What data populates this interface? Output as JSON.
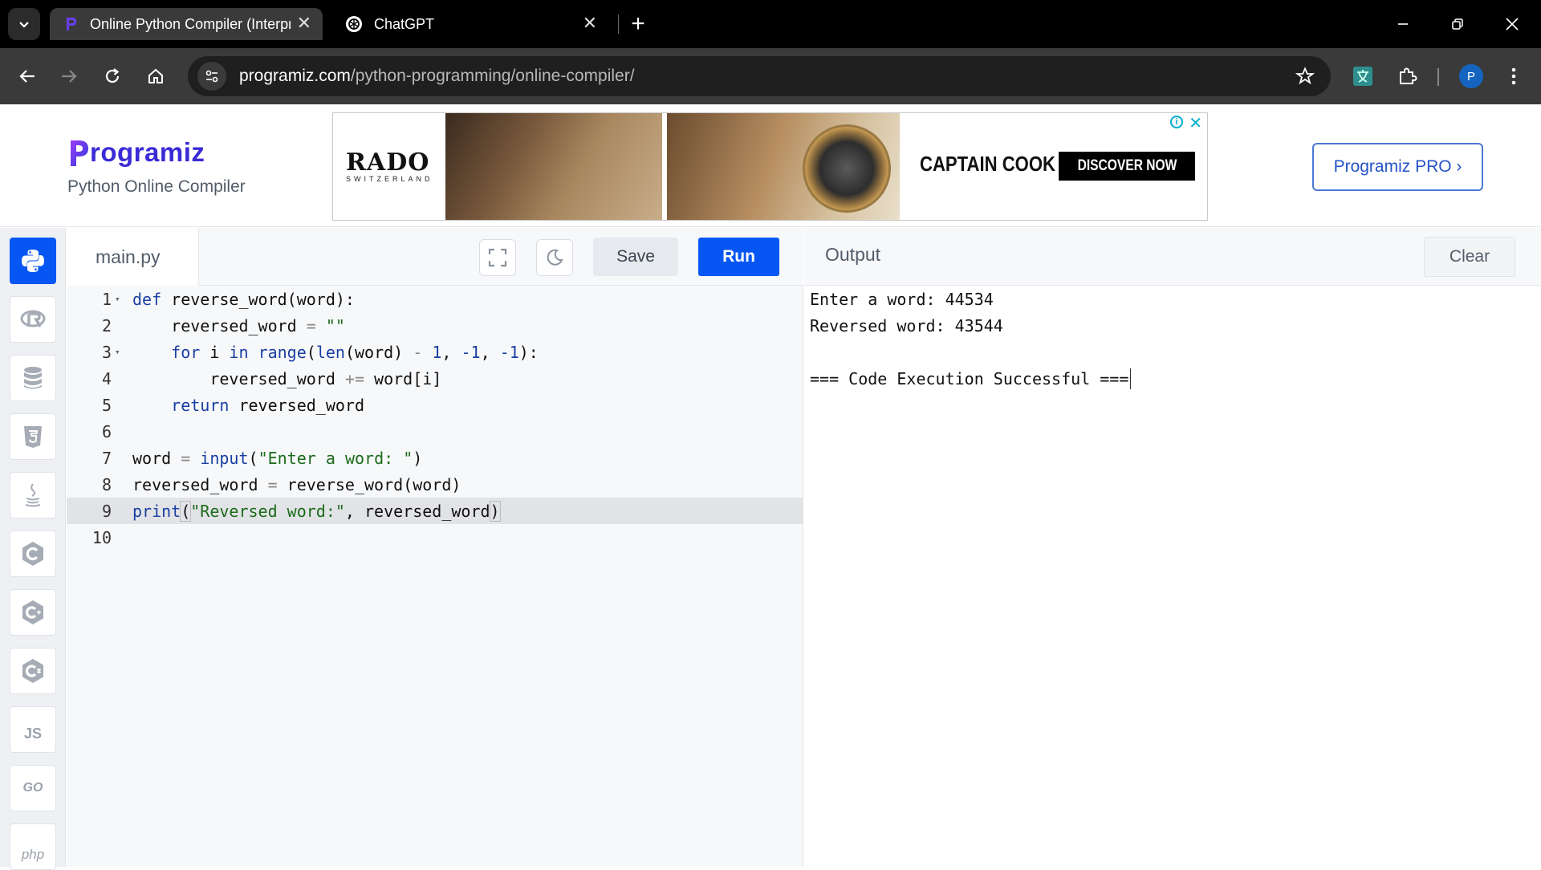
{
  "browser": {
    "tabs": [
      {
        "title": "Online Python Compiler (Interpreter)",
        "close": "✕",
        "active": true
      },
      {
        "title": "ChatGPT",
        "close": "✕",
        "active": false
      }
    ],
    "new_tab": "+",
    "url_host": "programiz.com",
    "url_path": "/python-programming/online-compiler/",
    "profile_initial": "P"
  },
  "header": {
    "logo_text": "rogramiz",
    "logo_initial": "P",
    "subtitle": "Python Online Compiler",
    "pro_button": "Programiz PRO ›"
  },
  "ad": {
    "brand": "RADO",
    "brand_sub": "SWITZERLAND",
    "headline": "CAPTAIN COOK",
    "cta": "DISCOVER NOW",
    "info": "i",
    "close": "✕"
  },
  "sidebar": {
    "languages": [
      "python",
      "r",
      "sql",
      "html",
      "java",
      "c",
      "cpp",
      "csharp",
      "js",
      "go",
      "php"
    ],
    "js_label": "JS",
    "go_label": "GO",
    "php_label": "php"
  },
  "editor": {
    "filename": "main.py",
    "save_label": "Save",
    "run_label": "Run",
    "line_numbers": [
      "1",
      "2",
      "3",
      "4",
      "5",
      "6",
      "7",
      "8",
      "9",
      "10"
    ]
  },
  "output": {
    "title": "Output",
    "clear_label": "Clear",
    "lines": [
      "Enter a word: 44534",
      "Reversed word: 43544",
      "",
      "=== Code Execution Successful ==="
    ]
  },
  "colors": {
    "accent": "#0556f3",
    "brand": "#3a2bd6",
    "keyword": "#1a3fa3",
    "string": "#1a6b1a"
  }
}
